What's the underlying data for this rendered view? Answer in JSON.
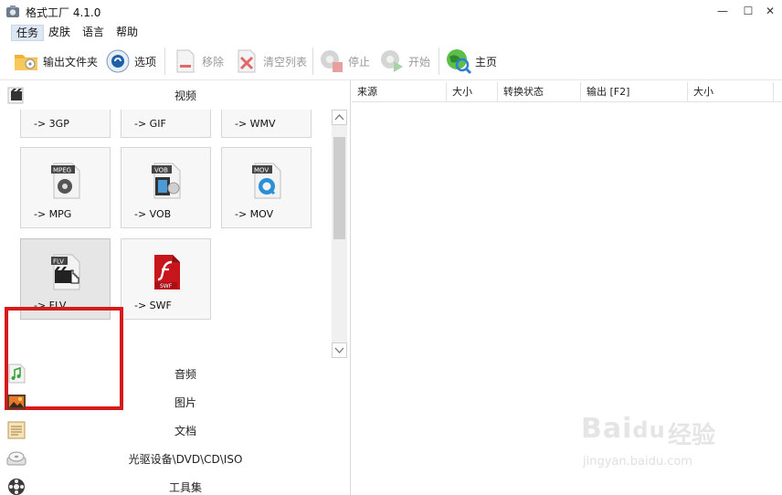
{
  "window": {
    "title": "格式工厂 4.1.0",
    "minimize_icon": "minimize-icon",
    "maximize_icon": "maximize-icon",
    "close_icon": "close-icon"
  },
  "menu": {
    "items": [
      {
        "label": "任务",
        "active": true
      },
      {
        "label": "皮肤",
        "active": false
      },
      {
        "label": "语言",
        "active": false
      },
      {
        "label": "帮助",
        "active": false
      }
    ]
  },
  "toolbar": {
    "output_folder": {
      "label": "输出文件夹",
      "icon": "folder-icon"
    },
    "options": {
      "label": "选项",
      "icon": "options-icon"
    },
    "remove": {
      "label": "移除",
      "icon": "remove-icon",
      "enabled": false
    },
    "clear_list": {
      "label": "清空列表",
      "icon": "clear-list-icon",
      "enabled": false
    },
    "stop": {
      "label": "停止",
      "icon": "stop-icon",
      "enabled": false
    },
    "start": {
      "label": "开始",
      "icon": "start-icon",
      "enabled": false
    },
    "home": {
      "label": "主页",
      "icon": "home-icon"
    }
  },
  "categories": {
    "video": {
      "label": "视频",
      "icon": "video-icon"
    },
    "audio": {
      "label": "音频",
      "icon": "audio-icon"
    },
    "picture": {
      "label": "图片",
      "icon": "picture-icon"
    },
    "document": {
      "label": "文档",
      "icon": "document-icon"
    },
    "optical": {
      "label": "光驱设备\\DVD\\CD\\ISO",
      "icon": "disc-icon"
    },
    "tools": {
      "label": "工具集",
      "icon": "tools-icon"
    }
  },
  "video_tiles": [
    {
      "label": "-> 3GP",
      "badge": ""
    },
    {
      "label": "-> GIF",
      "badge": ""
    },
    {
      "label": "-> WMV",
      "badge": ""
    },
    {
      "label": "-> MPG",
      "badge": "MPEG"
    },
    {
      "label": "-> VOB",
      "badge": "VOB"
    },
    {
      "label": "-> MOV",
      "badge": "MOV"
    },
    {
      "label": "-> FLV",
      "badge": "FLV",
      "selected": true
    },
    {
      "label": "-> SWF",
      "badge": "SWF"
    }
  ],
  "task_table": {
    "columns": [
      "来源",
      "大小",
      "转换状态",
      "输出 [F2]",
      "大小"
    ]
  },
  "watermark": {
    "brand": "Bai",
    "brand2": "du",
    "cn": "经验",
    "url": "jingyan.baidu.com"
  },
  "colors": {
    "highlight_border": "#d71b1b",
    "menu_active_bg": "#dde7f3",
    "swf_red": "#c8151c",
    "mov_blue": "#2a8fd6"
  }
}
